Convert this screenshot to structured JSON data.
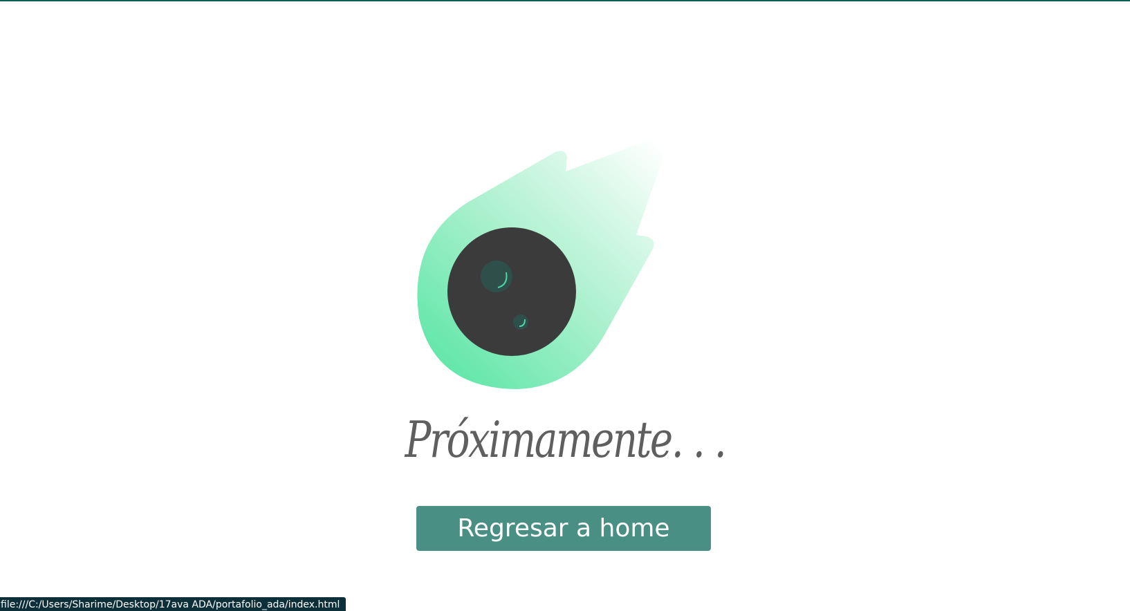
{
  "page": {
    "heading": "Próximamente. . .",
    "home_button_label": "Regresar a home"
  },
  "status_bar": {
    "link_url": "file:///C:/Users/Sharime/Desktop/17ava ADA/portafolio_ada/index.html"
  },
  "illustration": {
    "icon": "meteor-icon",
    "colors": {
      "flame_light": "#e4fbee",
      "flame_dark": "#5fe6a8",
      "rock": "#3b3b3b",
      "crater": "#2f4f4a",
      "crater_highlight": "#4fd6a5"
    }
  },
  "colors": {
    "accent": "#4a8f83",
    "top_border": "#0f5e58",
    "heading_text": "#5f5f5f"
  }
}
